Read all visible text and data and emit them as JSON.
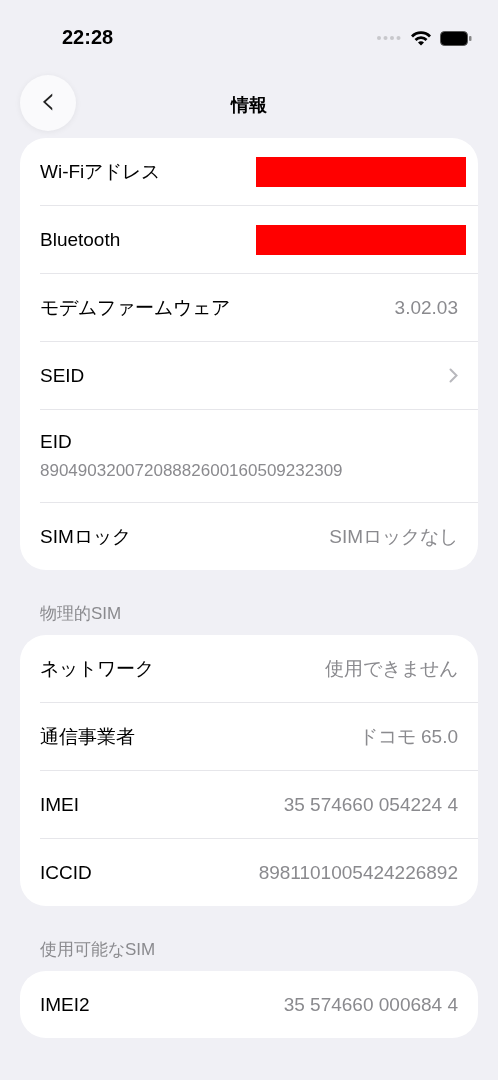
{
  "status_bar": {
    "time": "22:28"
  },
  "nav": {
    "title": "情報",
    "back": "‹"
  },
  "sections": [
    {
      "rows": [
        {
          "kind": "redacted",
          "label": "Wi-Fiアドレス"
        },
        {
          "kind": "redacted",
          "label": "Bluetooth"
        },
        {
          "kind": "value",
          "label": "モデムファームウェア",
          "value": "3.02.03"
        },
        {
          "kind": "chevron",
          "label": "SEID"
        },
        {
          "kind": "stacked",
          "label": "EID",
          "value": "89049032007208882600160509232309"
        },
        {
          "kind": "value",
          "label": "SIMロック",
          "value": "SIMロックなし"
        }
      ]
    },
    {
      "header": "物理的SIM",
      "rows": [
        {
          "kind": "value",
          "label": "ネットワーク",
          "value": "使用できません"
        },
        {
          "kind": "value",
          "label": "通信事業者",
          "value": "ドコモ 65.0"
        },
        {
          "kind": "value",
          "label": "IMEI",
          "value": "35 574660 054224 4"
        },
        {
          "kind": "value",
          "label": "ICCID",
          "value": "8981101005424226892"
        }
      ]
    },
    {
      "header": "使用可能なSIM",
      "rows": [
        {
          "kind": "value",
          "label": "IMEI2",
          "value": "35 574660 000684 4"
        }
      ]
    }
  ]
}
